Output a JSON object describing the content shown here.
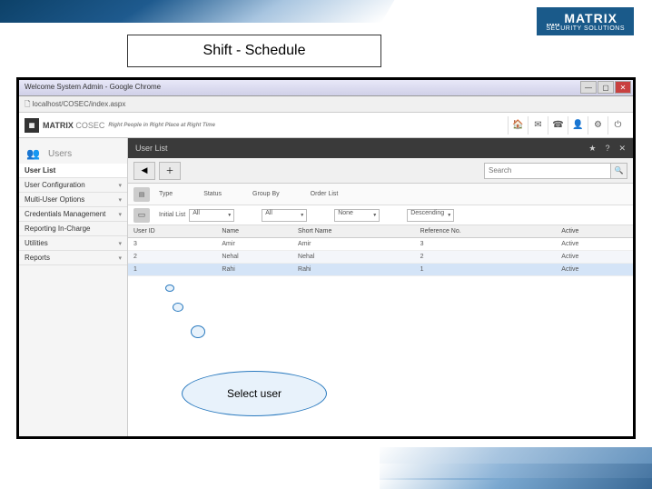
{
  "page_title": "Shift - Schedule",
  "logo": {
    "brand": "MATRIX",
    "tagline": "SECURITY SOLUTIONS"
  },
  "browser": {
    "window_title": "Welcome System Admin - Google Chrome",
    "url": "localhost/COSEC/index.aspx"
  },
  "app": {
    "brand": "MATRIX",
    "product": "COSEC",
    "tagline": "Right People in Right Place at Right Time"
  },
  "sidebar": {
    "header": "Users",
    "items": [
      {
        "label": "User List",
        "active": true
      },
      {
        "label": "User Configuration",
        "expandable": true
      },
      {
        "label": "Multi-User Options",
        "expandable": true
      },
      {
        "label": "Credentials Management",
        "expandable": true
      },
      {
        "label": "Reporting In-Charge",
        "expandable": false
      },
      {
        "label": "Utilities",
        "expandable": true
      },
      {
        "label": "Reports",
        "expandable": true
      }
    ]
  },
  "panel": {
    "title": "User List",
    "toolbar": {
      "search_placeholder": "Search"
    },
    "filters": {
      "type_label": "Type",
      "status_label": "Status",
      "groupby_label": "Group By",
      "orderlist_label": "Order List",
      "initial_list_label": "Initial List",
      "all": "All",
      "none": "None",
      "descending": "Descending"
    },
    "columns": [
      "User ID",
      "Name",
      "Short Name",
      "Reference No.",
      "Active"
    ],
    "rows": [
      {
        "id": "3",
        "name": "Amir",
        "short": "Amir",
        "ref": "3",
        "active": "Active"
      },
      {
        "id": "2",
        "name": "Nehal",
        "short": "Nehal",
        "ref": "2",
        "active": "Active"
      },
      {
        "id": "1",
        "name": "Rahi",
        "short": "Rahi",
        "ref": "1",
        "active": "Active"
      }
    ]
  },
  "annotation": "Select user"
}
